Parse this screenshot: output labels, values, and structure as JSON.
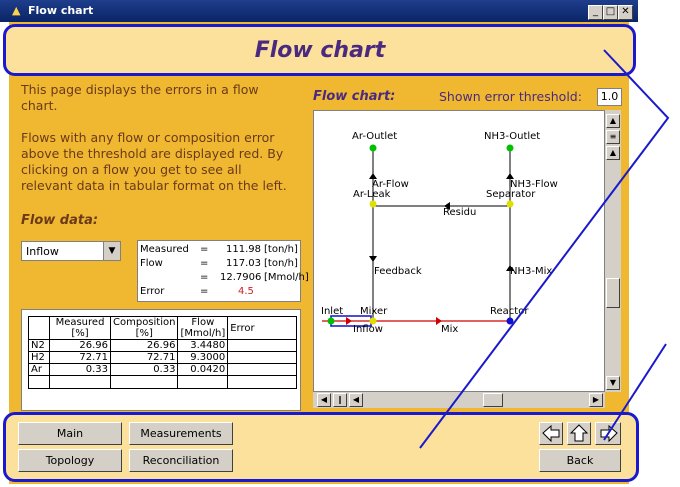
{
  "window": {
    "title": "Flow chart",
    "minimize": "_",
    "maximize": "□",
    "close": "✕"
  },
  "header": {
    "title": "Flow chart"
  },
  "info": {
    "paragraph1": [
      "This page displays the errors in a flow",
      "chart."
    ],
    "paragraph2": [
      "Flows with any flow or composition error",
      "above the threshold are displayed red. By",
      "clicking on a flow you get to see all",
      "relevant data in tabular format on the left."
    ]
  },
  "flow_data": {
    "label": "Flow data:",
    "select_value": "Inflow",
    "measures": [
      {
        "name": "Measured",
        "eq": "=",
        "value": "111.98",
        "unit": "[ton/h]"
      },
      {
        "name": "Flow",
        "eq": "=",
        "value": "117.03",
        "unit": "[ton/h]"
      },
      {
        "name": "",
        "eq": "=",
        "value": "12.7906",
        "unit": "[Mmol/h]"
      },
      {
        "name": "Error",
        "eq": "=",
        "value": "4.5",
        "unit": "",
        "color": "#d02020"
      }
    ],
    "table": {
      "headers": [
        [
          "",
          ""
        ],
        [
          "Measured",
          "[%]"
        ],
        [
          "Composition",
          "[%]"
        ],
        [
          "Flow",
          "[Mmol/h]"
        ],
        [
          "Error",
          ""
        ]
      ],
      "rows": [
        [
          "N2",
          "26.96",
          "26.96",
          "3.4480",
          ""
        ],
        [
          "H2",
          "72.71",
          "72.71",
          "9.3000",
          ""
        ],
        [
          "Ar",
          "0.33",
          "0.33",
          "0.0420",
          ""
        ]
      ]
    }
  },
  "chart": {
    "label": "Flow chart:",
    "threshold_label": "Shown error threshold:",
    "threshold_value": "1.0",
    "nodes": [
      "Ar-Outlet",
      "NH3-Outlet",
      "Ar-Flow",
      "NH3-Flow",
      "Ar-Leak",
      "Separator",
      "Residu",
      "Feedback",
      "NH3-Mix",
      "Inlet",
      "Mixer",
      "Reactor",
      "Inflow",
      "Mix"
    ],
    "colors": {
      "red_flow": "#d00000",
      "green": "#00c000",
      "yellow": "#e0e000",
      "blue": "#1010d0"
    }
  },
  "footer": {
    "main": "Main",
    "measurements": "Measurements",
    "topology": "Topology",
    "reconciliation": "Reconciliation",
    "back": "Back",
    "nav_icons": [
      "arrow-left-icon",
      "arrow-up-icon",
      "arrow-right-icon"
    ]
  },
  "accent_color": "#1a1acc"
}
